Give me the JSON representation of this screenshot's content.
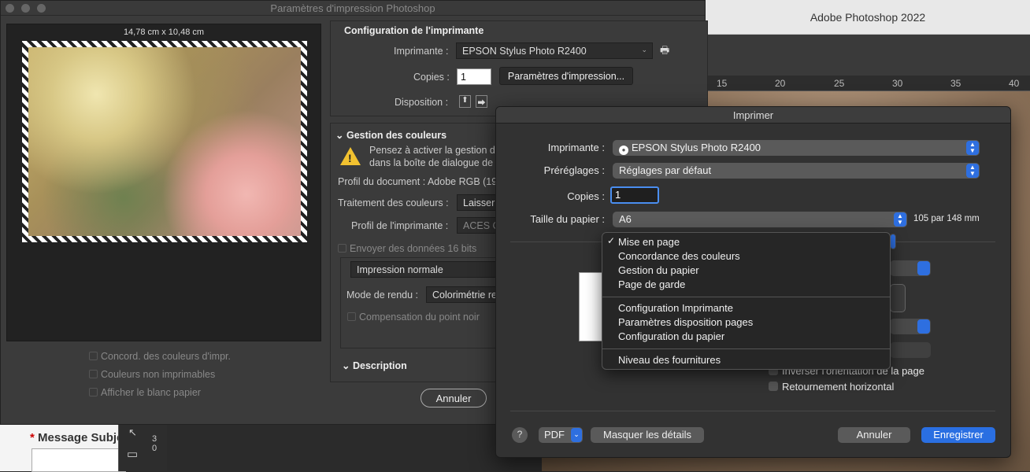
{
  "app": {
    "title": "Adobe Photoshop 2022",
    "ruler_ticks": [
      "15",
      "20",
      "25",
      "30",
      "35",
      "40"
    ]
  },
  "background": {
    "message_subject_star": "*",
    "message_subject_label": "Message Subje",
    "tool_numbers": [
      "3",
      "0"
    ]
  },
  "ps_dialog": {
    "title": "Paramètres d'impression Photoshop",
    "preview_size": "14,78 cm x 10,48 cm",
    "bottom_checks": [
      "Concord. des couleurs d'impr.",
      "Couleurs non imprimables",
      "Afficher le blanc papier"
    ],
    "printer_config": {
      "heading": "Configuration de l'imprimante",
      "printer_label": "Imprimante :",
      "printer_value": "EPSON Stylus Photo R2400",
      "copies_label": "Copies :",
      "copies_value": "1",
      "print_settings_button": "Paramètres d'impression...",
      "layout_label": "Disposition :"
    },
    "color_management": {
      "heading": "Gestion des couleurs",
      "warning_line1": "Pensez à activer la gestion d",
      "warning_line2": "dans la boîte de dialogue de",
      "document_profile": "Profil du document : Adobe RGB (19",
      "color_handling_label": "Traitement des couleurs :",
      "color_handling_value": "Laisser",
      "printer_profile_label": "Profil de l'imprimante :",
      "printer_profile_value": "ACES C",
      "send_16bit": "Envoyer des données 16 bits",
      "print_mode": "Impression normale",
      "rendering_label": "Mode de rendu :",
      "rendering_value": "Colorimétrie re",
      "black_point": "Compensation du point noir"
    },
    "description_heading": "Description",
    "cancel_button": "Annuler"
  },
  "mac_dialog": {
    "title": "Imprimer",
    "printer_label": "Imprimante :",
    "printer_value": "EPSON Stylus Photo R2400",
    "presets_label": "Préréglages :",
    "presets_value": "Réglages par défaut",
    "copies_label": "Copies :",
    "copies_value": "1",
    "paper_size_label": "Taille du papier :",
    "paper_size_value": "A6",
    "paper_size_dims": "105 par 148 mm",
    "inverse_orientation": "Inverser l'orientation de la page",
    "horizontal_flip": "Retournement horizontal",
    "help": "?",
    "pdf_button": "PDF",
    "hide_details_button": "Masquer les détails",
    "cancel_button": "Annuler",
    "save_button": "Enregistrer",
    "menu": {
      "checkmark": "✓",
      "group1": [
        "Mise en page",
        "Concordance des couleurs",
        "Gestion du papier",
        "Page de garde"
      ],
      "group2": [
        "Configuration Imprimante",
        "Paramètres disposition pages",
        "Configuration du papier"
      ],
      "group3": [
        "Niveau des fournitures"
      ]
    }
  },
  "colors": {
    "accent_blue": "#2a6fe2",
    "warning_yellow": "#f2c230"
  }
}
